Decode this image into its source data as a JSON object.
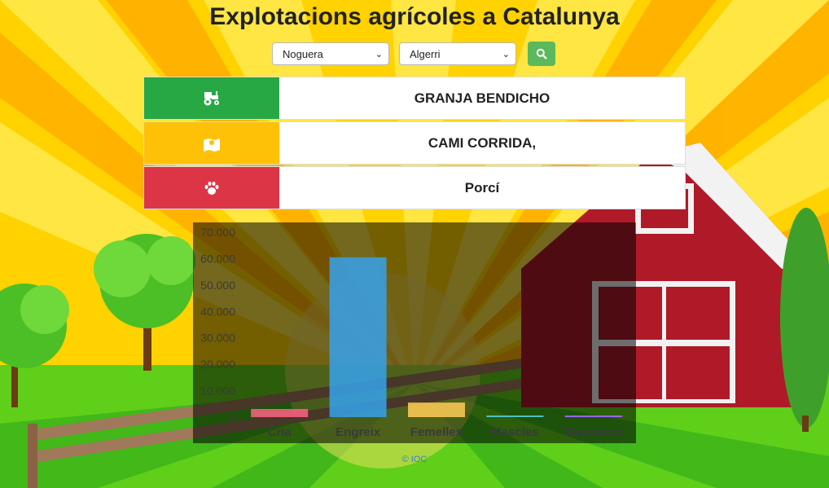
{
  "title": "Explotacions agrícoles a Catalunya",
  "filters": {
    "comarca": "Noguera",
    "municipi": "Algerri"
  },
  "search_button": {
    "icon": "search-icon"
  },
  "info_rows": [
    {
      "icon": "tractor-icon",
      "color": "#28a745",
      "value": "GRANJA BENDICHO"
    },
    {
      "icon": "map-marker-icon",
      "color": "#ffc107",
      "value": "CAMI CORRIDA,"
    },
    {
      "icon": "paw-icon",
      "color": "#dc3545",
      "value": "Porcí"
    }
  ],
  "chart_data": {
    "type": "bar",
    "categories": [
      "Cria",
      "Engreix",
      "Femelles",
      "Mascles",
      "Reposició"
    ],
    "values": [
      2800,
      60500,
      5500,
      0,
      0
    ],
    "colors": [
      "#ff6384",
      "#36a2eb",
      "#ffce56",
      "#4bc0c0",
      "#9966ff"
    ],
    "ylim": [
      0,
      70000
    ],
    "yticks": [
      "0",
      "10.000",
      "20.000",
      "30.000",
      "40.000",
      "50.000",
      "60.000",
      "70.000"
    ],
    "grid": false
  },
  "footer": "© IOC"
}
